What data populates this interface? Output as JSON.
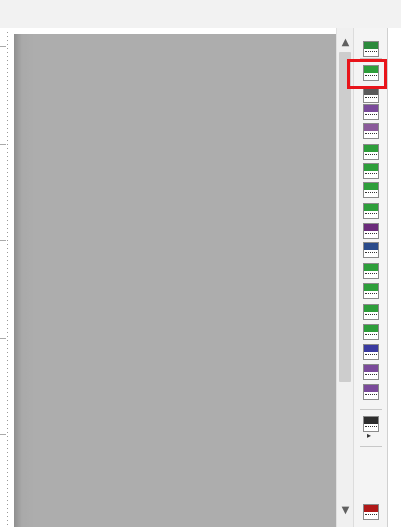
{
  "scrollbar": {
    "up_arrow": "▲",
    "down_arrow": "▼"
  },
  "palette": {
    "more_arrow": "▸",
    "tools": [
      {
        "name": "camera-tool",
        "color": "#2c8a3c"
      },
      {
        "name": "waveform-graph-tool",
        "color": "#2d9e3a"
      },
      {
        "name": "digital-io-tool",
        "color": "#5a5a5a"
      },
      {
        "name": "waveform-chart-tool",
        "color": "#7a4a9a"
      },
      {
        "name": "xy-graph-tool",
        "color": "#8a5a9a"
      },
      {
        "name": "numeric-display-tool",
        "color": "#2d9e3a"
      },
      {
        "name": "numeric-indicator-tool",
        "color": "#2d9e3a"
      },
      {
        "name": "digital-display-tool",
        "color": "#2d9e3a"
      },
      {
        "name": "meter-tool",
        "color": "#2d9e3a"
      },
      {
        "name": "spectrum-tool",
        "color": "#6a2a7a"
      },
      {
        "name": "trend-tool",
        "color": "#2a4a8a"
      },
      {
        "name": "histogram-tool",
        "color": "#2d9e3a"
      },
      {
        "name": "bar-chart-tool",
        "color": "#2d9e3a"
      },
      {
        "name": "matrix-tool",
        "color": "#2d9e3a"
      },
      {
        "name": "ag-graph-tool",
        "color": "#2d9e3a"
      },
      {
        "name": "ag-plot-tool",
        "color": "#3a3aa0"
      },
      {
        "name": "ag-wave-tool",
        "color": "#7a4a9a"
      },
      {
        "name": "trigger-tool",
        "color": "#7a4a9a"
      },
      {
        "name": "signal-tool",
        "color": "#2d2d2d"
      },
      {
        "name": "pen-tool",
        "color": "#b01818"
      }
    ]
  }
}
